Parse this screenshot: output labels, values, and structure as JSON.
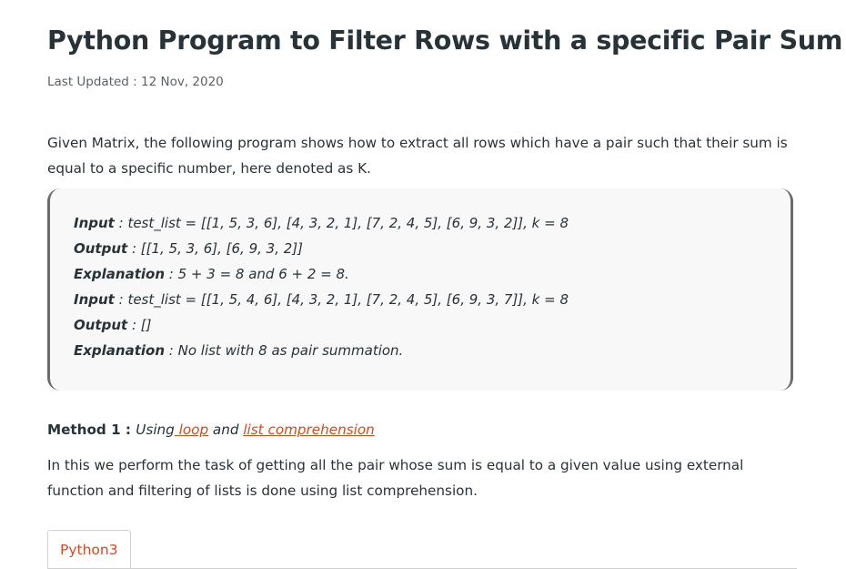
{
  "article": {
    "title": "Python Program to Filter Rows with a specific Pair Sum",
    "last_updated": "Last Updated : 12 Nov, 2020",
    "intro": "Given Matrix, the following program shows how to extract all rows which have a pair such that their sum is equal to a specific number, here denoted as K."
  },
  "example": {
    "lines": [
      {
        "key": "Input",
        "text": " : test_list = [[1, 5, 3, 6], [4, 3, 2, 1], [7, 2, 4, 5], [6, 9, 3, 2]], k = 8"
      },
      {
        "key": "Output",
        "text": " : [[1, 5, 3, 6], [6, 9, 3, 2]]"
      },
      {
        "key": "Explanation",
        "text": " : 5 + 3 = 8 and 6 + 2 = 8."
      },
      {
        "key": "Input",
        "text": " : test_list = [[1, 5, 4, 6], [4, 3, 2, 1], [7, 2, 4, 5], [6, 9, 3, 7]], k = 8"
      },
      {
        "key": "Output",
        "text": " : []"
      },
      {
        "key": "Explanation",
        "text": " : No list with 8 as pair summation."
      }
    ]
  },
  "method": {
    "label": "Method 1 : ",
    "using": "Using",
    "link1": " loop",
    "and": " and ",
    "link2": "list comprehension"
  },
  "method_description": "In this we perform the task of getting all the pair whose sum is equal to a given value using external function and filtering of lists is done using list comprehension.",
  "code_tabs": [
    {
      "label": "Python3"
    }
  ],
  "colors": {
    "link": "#d14b1f",
    "text": "#273239",
    "example_bg": "#f8f8f8"
  }
}
